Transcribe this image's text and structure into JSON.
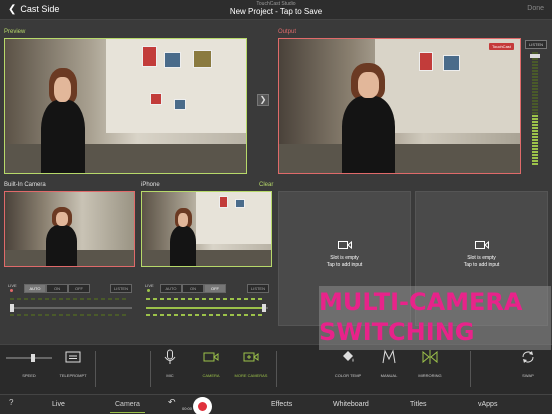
{
  "header": {
    "back_label": "Cast Side",
    "app_name": "TouchCast Studio",
    "project_title": "New Project - Tap to Save",
    "done_label": "Done"
  },
  "panels": {
    "preview_label": "Preview",
    "output_label": "Output",
    "output_badge": "TouchCast",
    "listen_label": "LISTEN",
    "builtin_label": "Built-In Camera",
    "iphone_label": "iPhone",
    "clear_label": "Clear",
    "slot_empty_1": "Slot is empty",
    "slot_empty_2": "Tap to add input"
  },
  "source_controls": {
    "live": "LIVE",
    "options": [
      "AUTO",
      "ON",
      "OFF"
    ],
    "listen": "LISTEN",
    "builtin_selected": "AUTO",
    "iphone_selected": "OFF",
    "builtin_level": 0.0,
    "iphone_level": 0.98
  },
  "toolbar": {
    "speed": "SPEED",
    "teleprompt": "TELEPROMPT",
    "mic": "MIC",
    "camera": "CAMERA",
    "more_cameras": "MORE CAMERAS",
    "color_temp": "COLOR TEMP",
    "manual": "MANUAL",
    "mirroring": "MIRRORING",
    "swap": "SWAP",
    "speed_level": 0.55
  },
  "tabs": {
    "live": "Live",
    "camera": "Camera",
    "effects": "Effects",
    "whiteboard": "Whiteboard",
    "titles": "Titles",
    "vapps": "vApps",
    "timer": "00:00",
    "help": "?"
  },
  "overlay": {
    "line1": "MULTI-CAMERA",
    "line2": "SWITCHING"
  },
  "colors": {
    "accent": "#9cc24a",
    "live_red": "#e06a6a",
    "record": "#e0313c",
    "overlay_text": "#e8238a"
  }
}
